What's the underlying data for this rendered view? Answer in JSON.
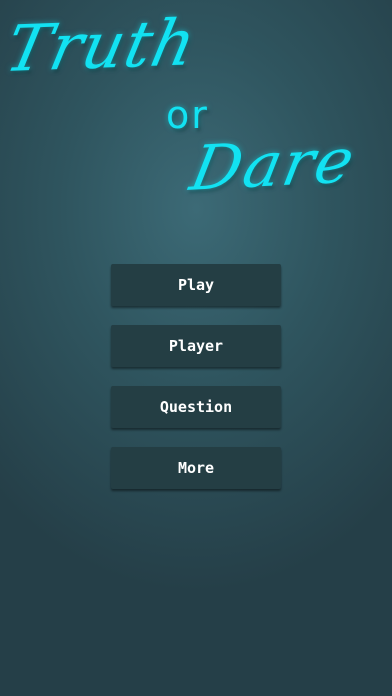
{
  "logo": {
    "line1": "Truth",
    "line2": "or",
    "line3": "Dare"
  },
  "menu": {
    "play": "Play",
    "player": "Player",
    "question": "Question",
    "more": "More"
  },
  "colors": {
    "accent": "#12e2f2",
    "button_bg": "#243e44",
    "background_center": "#3c6a76",
    "background_edge": "#253f48"
  }
}
